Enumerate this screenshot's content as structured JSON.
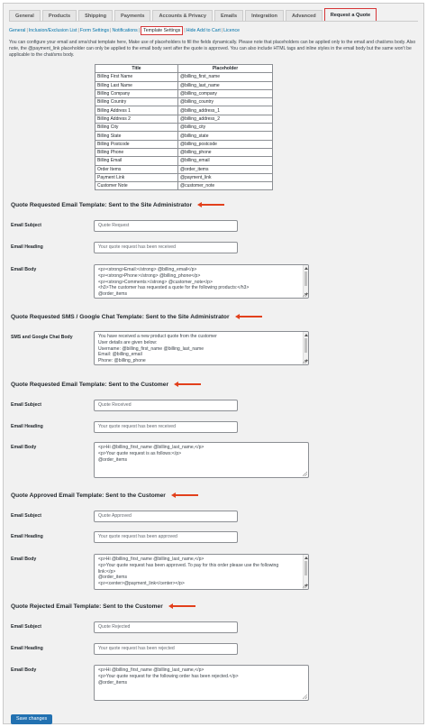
{
  "tabs": [
    "General",
    "Products",
    "Shipping",
    "Payments",
    "Accounts & Privacy",
    "Emails",
    "Integration",
    "Advanced",
    "Request a Quote"
  ],
  "subnav": [
    "General",
    "Inclusion/Exclusion List",
    "Form Settings",
    "Notifications",
    "Template Settings",
    "Hide Add to Cart",
    "Licence"
  ],
  "intro": "You can configure your email and sms/chat template here, Make use of placeholders to fill the fields dynamically. Please note that placeholders can be applied only to the email and chat/sms body. Also note, the @payment_link placeholder can only be applied to the email body sent after the quote is approved. You can also include HTML tags and inline styles in the email body but the same won't be applicable to the chat/sms body.",
  "placeholder_table": {
    "headers": [
      "Title",
      "Placeholder"
    ],
    "rows": [
      [
        "Billing First Name",
        "@billing_first_name"
      ],
      [
        "Billing Last Name",
        "@billing_last_name"
      ],
      [
        "Billing Company",
        "@billing_company"
      ],
      [
        "Billing Country",
        "@billing_country"
      ],
      [
        "Billing Address 1",
        "@billing_address_1"
      ],
      [
        "Billing Address 2",
        "@billing_address_2"
      ],
      [
        "Billing City",
        "@billing_city"
      ],
      [
        "Billing State",
        "@billing_state"
      ],
      [
        "Billing Postcode",
        "@billing_postcode"
      ],
      [
        "Billing Phone",
        "@billing_phone"
      ],
      [
        "Billing Email",
        "@billing_email"
      ],
      [
        "Order Items",
        "@order_items"
      ],
      [
        "Payment Link",
        "@payment_link"
      ],
      [
        "Customer Note",
        "@customer_note"
      ]
    ]
  },
  "sections": {
    "admin_email": {
      "title": "Quote Requested Email Template: Sent to the Site Administrator",
      "subject_label": "Email Subject",
      "subject_value": "Quote Request",
      "heading_label": "Email Heading",
      "heading_value": "Your quote request has been received",
      "body_label": "Email Body",
      "body_lines": [
        "<p><strong>Email:</strong> @billing_email</p>",
        "<p><strong>Phone:</strong> @billing_phone</p>",
        "<p><strong>Comments:</strong> @customer_note</p>",
        "<h3>The customer has requested a quote for the following products:</h3>",
        "@order_items"
      ]
    },
    "admin_sms": {
      "title": "Quote Requested SMS / Google Chat Template: Sent to the Site Administrator",
      "body_label": "SMS and Google Chat Body",
      "body_lines": [
        "You have received a new product quote from the customer",
        "User details are given below:",
        "Username: @billing_first_name @billing_last_name",
        "Email: @billing_email",
        "Phone: @billing_phone"
      ]
    },
    "customer_requested": {
      "title": "Quote Requested Email Template: Sent to the Customer",
      "subject_label": "Email Subject",
      "subject_value": "Quote Received",
      "heading_label": "Email Heading",
      "heading_value": "Your quote request has been received",
      "body_label": "Email Body",
      "body_lines": [
        "<p>Hi @billing_first_name @billing_last_name,</p>",
        "<p>Your quote request is as follows:</p>",
        "@order_items"
      ]
    },
    "customer_approved": {
      "title": "Quote Approved Email Template: Sent to the Customer",
      "subject_label": "Email Subject",
      "subject_value": "Quote Approved",
      "heading_label": "Email Heading",
      "heading_value": "Your quote request has been approved",
      "body_label": "Email Body",
      "body_lines": [
        "<p>Hi @billing_first_name @billing_last_name,</p>",
        "<p>Your quote request has been approved. To pay for this order please use the following",
        "link:</p>",
        "@order_items",
        "<p><center>@payment_link</center></p>"
      ]
    },
    "customer_rejected": {
      "title": "Quote Rejected Email Template: Sent to the Customer",
      "subject_label": "Email Subject",
      "subject_value": "Quote Rejected",
      "heading_label": "Email Heading",
      "heading_value": "Your quote request has been rejected",
      "body_label": "Email Body",
      "body_lines": [
        "<p>Hi @billing_first_name @billing_last_name,</p>",
        "<p>Your quote request for the following order has been rejected.</p>",
        "@order_items"
      ]
    }
  },
  "save_label": "Save changes",
  "colors": {
    "accent": "#2271b1",
    "highlight": "#d63638",
    "arrow": "#e2401c",
    "link": "#0073aa"
  }
}
